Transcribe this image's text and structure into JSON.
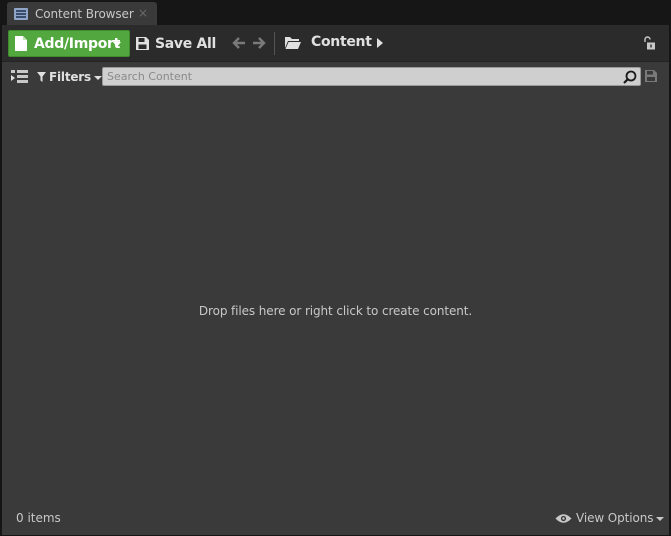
{
  "tab": {
    "title": "Content Browser",
    "close_glyph": "×",
    "icon": "content-browser-icon"
  },
  "toolbar": {
    "add_import_label": "Add/Import",
    "save_all_label": "Save All",
    "path_label": "Content",
    "icons": [
      "new-asset-icon",
      "floppy-icon",
      "back-arrow-icon",
      "forward-arrow-icon",
      "folder-icon",
      "path-arrow-icon",
      "lock-icon"
    ]
  },
  "filters": {
    "label": "Filters",
    "search_placeholder": "Search Content",
    "search_value": ""
  },
  "content": {
    "empty_message": "Drop files here or right click to create content."
  },
  "footer": {
    "item_count": "0 items",
    "view_options_label": "View Options"
  },
  "colors": {
    "panel_bg": "#3a3a3a",
    "toolbar_bg": "#2b2b2b",
    "add_button": "#52a83f",
    "search_bg": "#cfcfcf"
  }
}
